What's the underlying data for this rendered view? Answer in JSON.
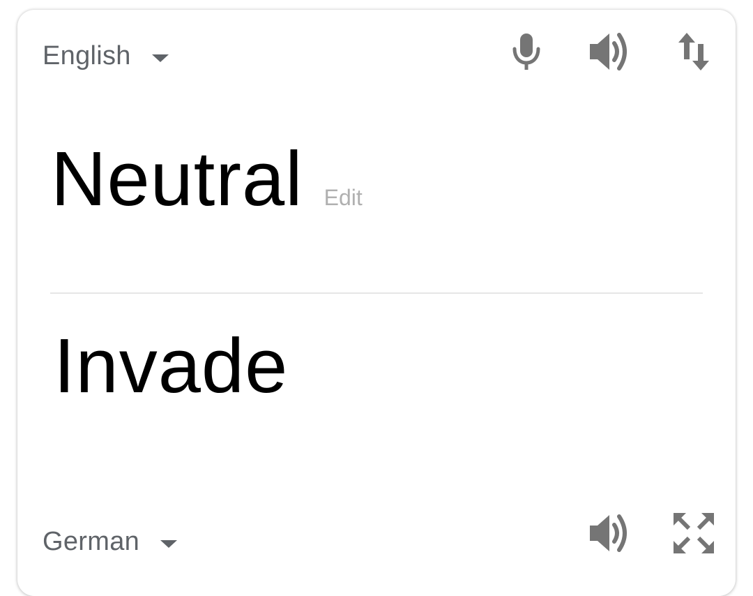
{
  "source": {
    "language": "English",
    "text": "Neutral",
    "edit_label": "Edit",
    "icons": [
      "microphone-icon",
      "speaker-icon",
      "swap-languages-icon"
    ]
  },
  "target": {
    "language": "German",
    "text": "Invade",
    "icons": [
      "speaker-icon",
      "fullscreen-icon"
    ]
  },
  "colors": {
    "icon": "#757575",
    "label": "#5f6368",
    "edit": "#b0b0b0",
    "text": "#000000",
    "divider": "#e6e6e6"
  }
}
